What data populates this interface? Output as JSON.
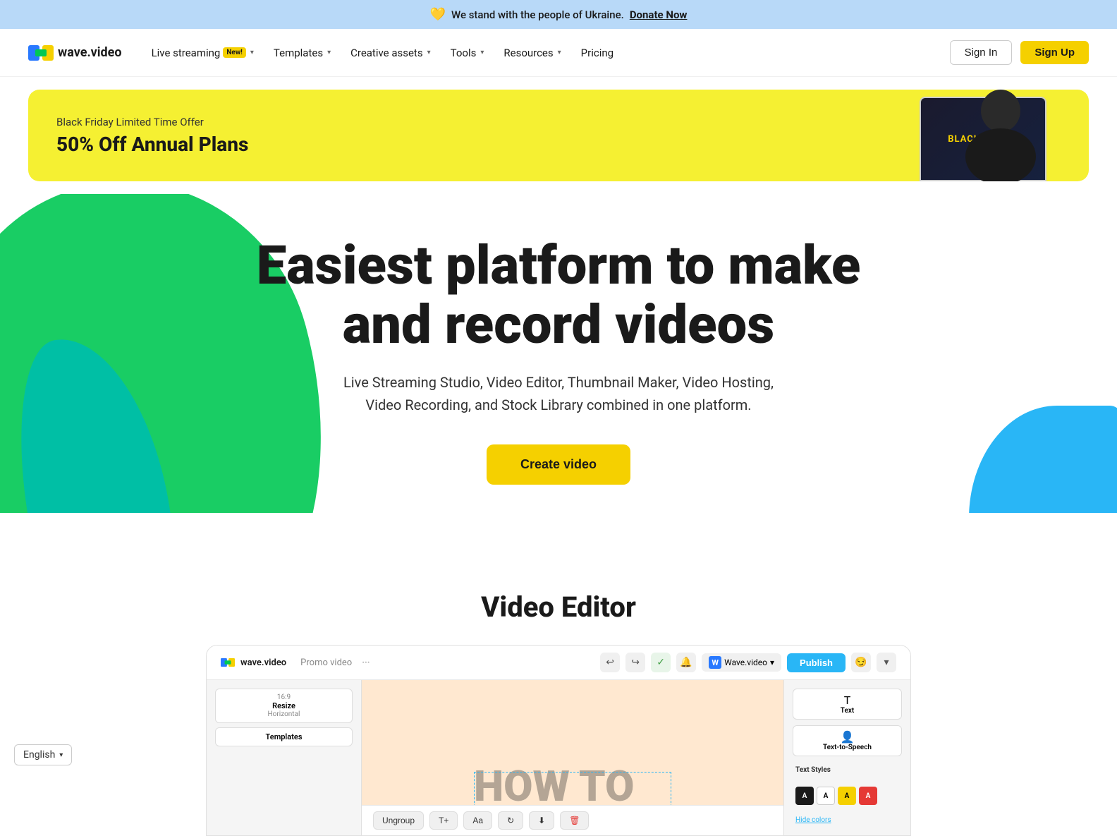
{
  "banner": {
    "emoji": "💛",
    "text": "We stand with the people of Ukraine.",
    "link_text": "Donate Now"
  },
  "nav": {
    "logo_text": "wave.video",
    "items": [
      {
        "id": "live-streaming",
        "label": "Live streaming",
        "badge": "New!",
        "has_dropdown": true
      },
      {
        "id": "templates",
        "label": "Templates",
        "has_dropdown": true
      },
      {
        "id": "creative-assets",
        "label": "Creative assets",
        "has_dropdown": true
      },
      {
        "id": "tools",
        "label": "Tools",
        "has_dropdown": true
      },
      {
        "id": "resources",
        "label": "Resources",
        "has_dropdown": true
      },
      {
        "id": "pricing",
        "label": "Pricing",
        "has_dropdown": false
      }
    ],
    "signin_label": "Sign In",
    "signup_label": "Sign Up"
  },
  "promo": {
    "subtitle": "Black Friday Limited Time Offer",
    "title": "50% Off Annual Plans",
    "screen_label": "BLACK FRIDAY"
  },
  "hero": {
    "title_line1": "Easiest platform to make",
    "title_line2": "and record videos",
    "subtitle": "Live Streaming Studio, Video Editor, Thumbnail Maker, Video Hosting, Video Recording, and Stock Library combined in one platform.",
    "cta_label": "Create video"
  },
  "video_editor": {
    "section_title": "Video Editor",
    "editor_logo": "wave.video",
    "promo_video_label": "Promo video",
    "publish_label": "Publish",
    "canvas_text": "HOW TO",
    "toolbar_btns": [
      "Ungroup",
      "T+",
      "Aa",
      "🔄",
      "⬇",
      "🗑"
    ],
    "right_panel": {
      "text_label": "Text",
      "tts_label": "Text-to-Speech",
      "text_styles_label": "Text Styles",
      "hide_colors_label": "Hide colors"
    },
    "sidebar_items": [
      {
        "label": "Resize\nHorizontal"
      },
      {
        "label": "Templates"
      }
    ]
  },
  "footer": {
    "language_label": "English"
  },
  "colors": {
    "yellow": "#f5d000",
    "green": "#00c853",
    "teal": "#00bfa5",
    "blue": "#29b6f6",
    "banner_bg": "#b8d9f8"
  }
}
